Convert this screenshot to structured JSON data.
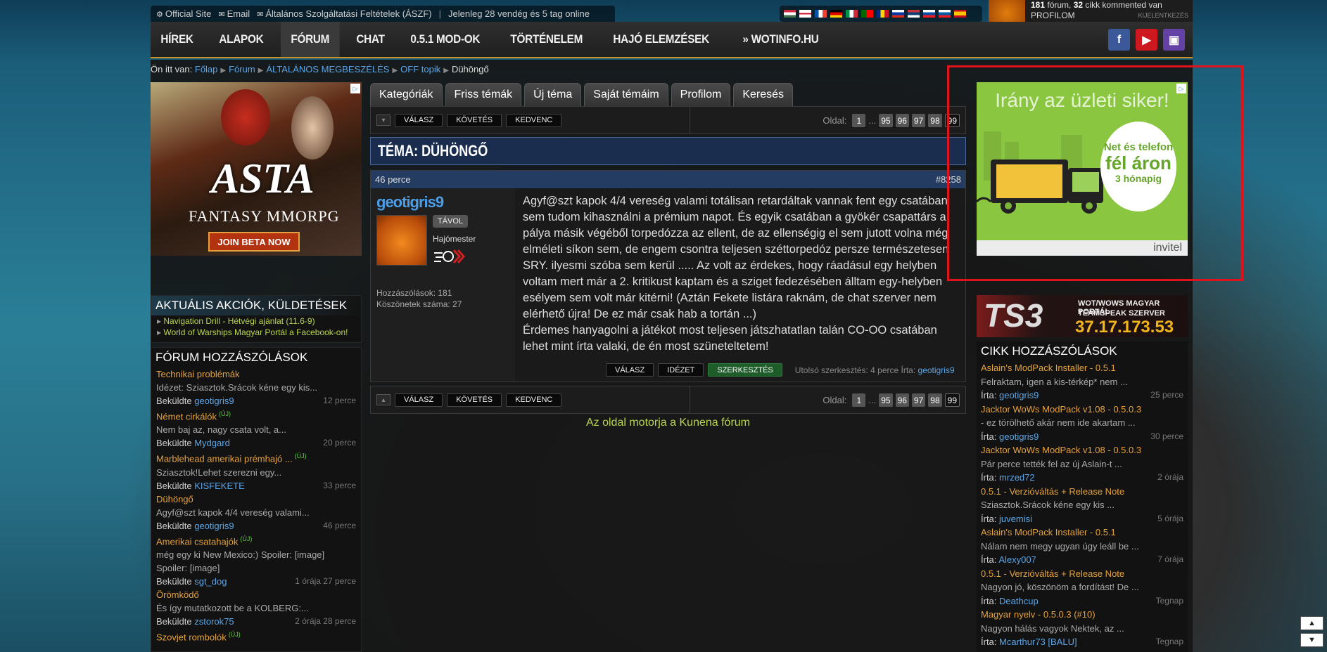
{
  "topbar": {
    "links": [
      {
        "label": "Official Site",
        "icon": "steam-icon"
      },
      {
        "label": "Email",
        "icon": "mail-icon"
      },
      {
        "label": "Általános Szolgáltatási Feltételek (ÁSZF)",
        "icon": "mail-icon"
      }
    ],
    "online": "Jelenleg 28 vendég és 5 tag online"
  },
  "user": {
    "line1_num": "181",
    "line1_text": " fórum, ",
    "line1_num2": "32",
    "line1_text2": " cikk kommented van",
    "profile": "PROFILOM",
    "logout": "KIJELENTKEZÉS"
  },
  "nav": {
    "items": [
      "HÍREK",
      "ALAPOK",
      "FÓRUM",
      "CHAT",
      "0.5.1 MOD-OK",
      "TÖRTÉNELEM",
      "HAJÓ ELEMZÉSEK",
      "» WOTINFO.HU"
    ]
  },
  "breadcrumb": {
    "prefix": "Ön itt van:",
    "items": [
      "Főlap",
      "Fórum",
      "ÁLTALÁNOS MEGBESZÉLÉS",
      "OFF topik"
    ],
    "current": "Dühöngő"
  },
  "ad_left": {
    "title": "ASTA",
    "subtitle": "FANTASY MMORPG",
    "button": "JOIN BETA NOW"
  },
  "actions_widget": {
    "title": "AKTUÁLIS AKCIÓK, KÜLDETÉSEK",
    "items": [
      "Navigation Drill - Hétvégi ajánlat (11.6-9)",
      "World of Warships Magyar Portál a Facebook-on!"
    ]
  },
  "forum_widget": {
    "title": "FÓRUM HOZZÁSZÓLÁSOK",
    "by_label": "Beküldte",
    "new_label": "(ÚJ)",
    "posts": [
      {
        "title": "Technikai problémák",
        "excerpt": "Idézet: Sziasztok.Srácok kéne egy kis...",
        "user": "geotigris9",
        "time": "12 perce"
      },
      {
        "title": "Német cirkálók",
        "excerpt": "Nem baj az, nagy csata volt, a...",
        "user": "Mydgard",
        "time": "20 perce"
      },
      {
        "title": "Marblehead amerikai prémhajó ...",
        "excerpt": "Sziasztok!Lehet szerezni egy...",
        "user": "KISFEKETE",
        "time": "33 perce"
      },
      {
        "title": "Dühöngő",
        "excerpt": "Agyf@szt kapok 4/4 vereség valami...",
        "user": "geotigris9",
        "time": "46 perce"
      },
      {
        "title": "Amerikai csatahajók",
        "excerpt": "még egy ki New Mexico:) Spoiler: [image]",
        "excerpt2": "Spoiler: [image]",
        "user": "sgt_dog",
        "time": "1 órája 27 perce"
      },
      {
        "title": "Örömködő",
        "excerpt": "És így mutatkozott be a KOLBERG:...",
        "user": "zstorok75",
        "time": "2 órája 28 perce"
      },
      {
        "title": "Szovjet rombolók"
      }
    ]
  },
  "tabs": [
    "Kategóriák",
    "Friss témák",
    "Új téma",
    "Saját témáim",
    "Profilom",
    "Keresés"
  ],
  "toolbar": {
    "reply": "VÁLASZ",
    "follow": "KÖVETÉS",
    "favorite": "KEDVENC",
    "page_label": "Oldal:",
    "pages": [
      "1",
      "...",
      "95",
      "96",
      "97",
      "98",
      "99"
    ]
  },
  "topic": {
    "title": "TÉMA: DÜHÖNGŐ"
  },
  "message": {
    "time": "46 perce",
    "number": "#8258",
    "author": "geotigris9",
    "status": "TÁVOL",
    "rank": "Hajómester",
    "posts_label": "Hozzászólások: 181",
    "thanks_label": "Köszönetek száma: 27",
    "body1": "Agyf@szt kapok 4/4 vereség valami totálisan retardáltak vannak fent egy csatában sem tudom kihasználni a prémium napot. És egyik csatában a gyökér csapattárs a pálya másik végéből torpedózza az ellent, de az ellenségig el sem jutott volna még elméleti síkon sem, de engem csontra teljesen széttorpedóz persze természetesen SRY. ilyesmi szóba sem kerül ..... Az volt az érdekes, hogy ráadásul egy helyben voltam mert már a 2. kritikust kaptam és a sziget fedezésében álltam egy-helyben esélyem sem volt már kitérni! (Aztán Fekete listára raknám, de chat szerver nem elérhető újra! De ez már csak hab a tortán ...)",
    "body2": "Érdemes hanyagolni a játékot most teljesen játszhatatlan talán CO-OO csatában lehet mint írta valaki, de én most szüneteltetem!",
    "reply": "VÁLASZ",
    "quote": "IDÉZET",
    "edit": "SZERKESZTÉS",
    "edited_label": "Utolsó szerkesztés: 4 perce Írta:",
    "edited_user": "geotigris9"
  },
  "footer": {
    "text": "Az oldal motorja a Kunena fórum"
  },
  "ad_right": {
    "headline": "Irány az üzleti siker!",
    "bubble1": "Net és telefon",
    "bubble2": "fél áron",
    "bubble3": "3 hónapig",
    "brand": "invitel"
  },
  "ts3": {
    "logo": "TS3",
    "line1": "WOT/WOWS MAGYAR PORTÁL",
    "line2": "TEAMSPEAK SZERVER",
    "ip": "37.17.173.53"
  },
  "comments_widget": {
    "title": "CIKK HOZZÁSZÓLÁSOK",
    "by_label": "Írta:",
    "posts": [
      {
        "title": "Aslain's ModPack Installer - 0.5.1",
        "excerpt": "Felraktam, igen a kis-térkép* nem ...",
        "user": "geotigris9",
        "time": "25 perce"
      },
      {
        "title": "Jacktor WoWs ModPack v1.08 - 0.5.0.3",
        "excerpt": "- ez törölhető akár nem ide akartam ...",
        "user": "geotigris9",
        "time": "30 perce"
      },
      {
        "title": "Jacktor WoWs ModPack v1.08 - 0.5.0.3",
        "excerpt": "Pár perce tették fel az új Aslain-t ...",
        "user": "mrzed72",
        "time": "2 órája"
      },
      {
        "title": "0.5.1 - Verzióváltás + Release Note",
        "excerpt": "Sziasztok.Srácok kéne egy kis ...",
        "user": "juvemisi",
        "time": "5 órája"
      },
      {
        "title": "Aslain's ModPack Installer - 0.5.1",
        "excerpt": "Nálam nem megy ugyan úgy leáll be ...",
        "user": "Alexy007",
        "time": "7 órája"
      },
      {
        "title": "0.5.1 - Verzióváltás + Release Note",
        "excerpt": "Nagyon jó, köszönöm a fordítást! De ...",
        "user": "Deathcup",
        "time": "Tegnap"
      },
      {
        "title": "Magyar nyelv - 0.5.0.3 (#10)",
        "excerpt": "Nagyon hálás vagyok Nektek, az ...",
        "user": "Mcarthur73 [BALU]",
        "time": "Tegnap"
      }
    ]
  },
  "colors": {
    "accent": "#c8942a",
    "link": "#5aa6e8",
    "topic_title": "#e6a23c",
    "highlight": "#e0121b"
  }
}
